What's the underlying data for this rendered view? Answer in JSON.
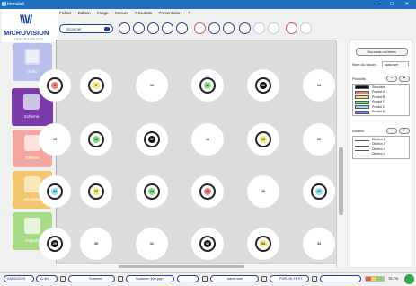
{
  "window": {
    "title": "Immulab",
    "controls": {
      "minimize": "–",
      "maximize": "□",
      "close": "✕"
    }
  },
  "logo": {
    "mark": "\\\\\\//",
    "brand": "MICROVISION",
    "sub": "INSTRUMENTS"
  },
  "menu": [
    "Fichier",
    "Edition",
    "Image",
    "Mesure",
    "Résultats",
    "Présentation",
    "?"
  ],
  "toolbar": {
    "mode_select": "Scanner"
  },
  "sidebar": [
    {
      "key": "video",
      "label": "Vidéo",
      "icon": "camera-icon"
    },
    {
      "key": "schema",
      "label": "Schéma",
      "icon": "schema-icon",
      "active": true
    },
    {
      "key": "tableau",
      "label": "Tableau",
      "icon": "table-icon"
    },
    {
      "key": "resultats",
      "label": "Résultats",
      "icon": "results-icon"
    },
    {
      "key": "rapport",
      "label": "Rapport",
      "icon": "printer-icon"
    }
  ],
  "wells": [
    {
      "num": "4",
      "color": "#f08080",
      "ring": true
    },
    {
      "num": "9",
      "color": "#f5e870",
      "ring": true
    },
    {
      "num": "10",
      "color": "",
      "ring": false
    },
    {
      "num": "11",
      "color": "#7fdc7f",
      "ring": true
    },
    {
      "num": "12",
      "color": "#111111",
      "text": "#ffffff",
      "ring": true
    },
    {
      "num": "13",
      "color": "",
      "ring": false
    },
    {
      "num": "15",
      "color": "",
      "ring": false
    },
    {
      "num": "16",
      "color": "#7fdc7f",
      "ring": true
    },
    {
      "num": "17",
      "color": "#111111",
      "text": "#ffffff",
      "ring": true
    },
    {
      "num": "18",
      "color": "",
      "ring": false
    },
    {
      "num": "19",
      "color": "#f5e870",
      "ring": true
    },
    {
      "num": "20",
      "color": "",
      "ring": false
    },
    {
      "num": "22",
      "color": "#8fe0f0",
      "ring": true
    },
    {
      "num": "23",
      "color": "#f5e870",
      "ring": true
    },
    {
      "num": "24",
      "color": "#7fdc7f",
      "ring": true
    },
    {
      "num": "25",
      "color": "#f08080",
      "ring": true
    },
    {
      "num": "26",
      "color": "",
      "ring": false
    },
    {
      "num": "27",
      "color": "#8fe0f0",
      "ring": true
    },
    {
      "num": "29",
      "color": "#111111",
      "text": "#ffffff",
      "ring": true
    },
    {
      "num": "30",
      "color": "",
      "ring": false
    },
    {
      "num": "31",
      "color": "",
      "ring": false
    },
    {
      "num": "32",
      "color": "#111111",
      "text": "#ffffff",
      "ring": true
    },
    {
      "num": "33",
      "color": "#f5e870",
      "ring": true
    },
    {
      "num": "34",
      "color": "",
      "ring": false
    }
  ],
  "panel": {
    "new_schema": "Nouveau schéma",
    "vaccin_label": "Nom du vaccin :",
    "vaccin_value": "sans nom",
    "produits_label": "Produits",
    "dilution_label": "Dilution",
    "minus": "−",
    "plus": "+",
    "produits": [
      {
        "label": "Standard",
        "color": "#111111"
      },
      {
        "label": "Produit A",
        "color": "#f08080"
      },
      {
        "label": "Produit B",
        "color": "#f5e870"
      },
      {
        "label": "Produit C",
        "color": "#7fdc7f"
      },
      {
        "label": "Produit D",
        "color": "#8fe0f0"
      },
      {
        "label": "Produit E",
        "color": "#7b7bf0"
      }
    ],
    "dilutions": [
      "Dilution 1",
      "Dilution 2",
      "Dilution 3",
      "Dilution 4"
    ]
  },
  "status": {
    "date": "23/02/2023",
    "time": "11:40",
    "source": "Scanner",
    "resolution": "Scanner 300 ppp",
    "name": "sans nom",
    "file": "PVR-05-TEST",
    "zoom": "76,7%"
  }
}
